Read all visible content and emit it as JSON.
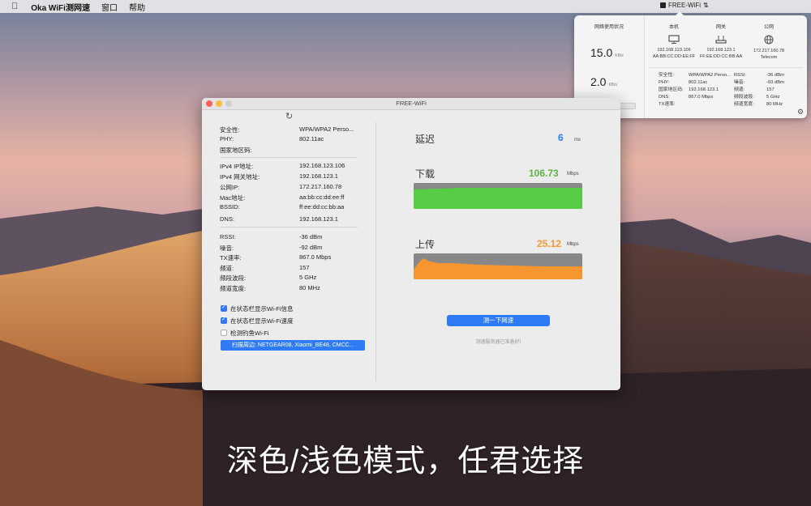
{
  "menubar": {
    "apple": "",
    "app_name": "Oka WiFi测网速",
    "menu_window": "窗口",
    "menu_help": "帮助",
    "tray_ssid": "FREE-WiFi"
  },
  "popover": {
    "usage_title": "网络使用状况",
    "download_value": "15.0",
    "download_unit": "KB/s",
    "upload_value": "2.0",
    "upload_unit": "KB/s",
    "columns": [
      {
        "title": "本机",
        "ip": "192.168.123.106",
        "mac": "AA:BB:CC:DD:EE:FF"
      },
      {
        "title": "网关",
        "ip": "192.168.123.1",
        "mac": "FF:EE:DD:CC:BB:AA"
      },
      {
        "title": "公网",
        "ip": "172.217.160.78",
        "mac": "Telecom"
      }
    ],
    "left_info": [
      {
        "label": "安全性:",
        "value": "WPA/WPA2 Perso..."
      },
      {
        "label": "PHY:",
        "value": "802.11ac"
      },
      {
        "label": "国家地区码:",
        "value": ""
      },
      {
        "label": "DNS:",
        "value": "192.168.123.1"
      },
      {
        "label": "TX速率:",
        "value": "867.0 Mbps"
      }
    ],
    "right_info": [
      {
        "label": "RSSI:",
        "value": "-36 dBm"
      },
      {
        "label": "噪音:",
        "value": "-93 dBm"
      },
      {
        "label": "频道:",
        "value": "157"
      },
      {
        "label": "频段波段:",
        "value": "5 GHz"
      },
      {
        "label": "频道宽度:",
        "value": "80 MHz"
      }
    ]
  },
  "window": {
    "title": "FREE-WiFi",
    "info_group1": [
      {
        "label": "安全性:",
        "value": "WPA/WPA2 Perso..."
      },
      {
        "label": "PHY:",
        "value": "802.11ac"
      },
      {
        "label": "国家地区码:",
        "value": ""
      }
    ],
    "info_group2": [
      {
        "label": "IPv4 IP地址:",
        "value": "192.168.123.106"
      },
      {
        "label": "IPv4 网关地址:",
        "value": "192.168.123.1"
      },
      {
        "label": "公网IP:",
        "value": "172.217.160.78"
      },
      {
        "label": "Mac地址:",
        "value": "aa:bb:cc:dd:ee:ff"
      },
      {
        "label": "BSSID:",
        "value": "ff:ee:dd:cc:bb:aa"
      },
      {
        "label": "DNS:",
        "value": "192.168.123.1"
      }
    ],
    "info_group3": [
      {
        "label": "RSSI:",
        "value": "-36 dBm"
      },
      {
        "label": "噪音:",
        "value": "-92 dBm"
      },
      {
        "label": "TX速率:",
        "value": "867.0 Mbps"
      },
      {
        "label": "频道:",
        "value": "157"
      },
      {
        "label": "频段波段:",
        "value": "5 GHz"
      },
      {
        "label": "频道宽度:",
        "value": "80 MHz"
      }
    ],
    "checkboxes": [
      {
        "label": "在状态栏显示Wi-Fi信息",
        "checked": true
      },
      {
        "label": "在状态栏显示Wi-Fi速度",
        "checked": true
      },
      {
        "label": "检测钓鱼Wi-Fi",
        "checked": false
      }
    ],
    "scan_button": "扫描周边: NETGEAR08, Xiaomi_BE48, CMCC...",
    "latency_label": "延迟",
    "latency_value": "6",
    "latency_unit": "ms",
    "download_label": "下载",
    "download_value": "106.73",
    "download_unit": "Mbps",
    "upload_label": "上传",
    "upload_value": "25.12",
    "upload_unit": "Mbps",
    "test_button": "测一下网速",
    "hint": "测速服务器已准备好!",
    "colors": {
      "download": "#58cc47",
      "upload": "#f7962e",
      "latency": "#2f7bf5",
      "accent": "#2f7bf5"
    }
  },
  "caption": "深色/浅色模式，任君选择"
}
